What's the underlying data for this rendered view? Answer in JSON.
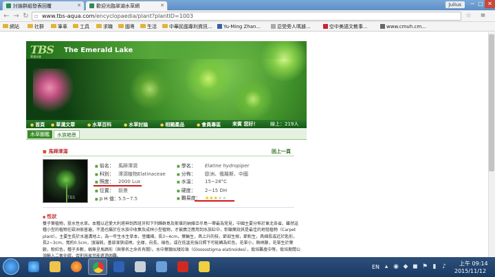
{
  "browser": {
    "tabs": [
      {
        "label": "討論群組發表回覆",
        "active": false
      },
      {
        "label": "歡迎光臨翠湖水草網",
        "active": true
      }
    ],
    "user_badge": "Julius",
    "window_controls": {
      "minimize": "─",
      "maximize": "□",
      "close": "✕"
    },
    "address": {
      "host": "www.tbs-aqua.com",
      "path": "/encyclopaedia/plant?plantID=1003"
    },
    "bookmarks": [
      "網站",
      "社群",
      "筆車",
      "工具",
      "求職",
      "國粵",
      "生活",
      "中華民國專利資訊...",
      "Yu-Ming Zhan...",
      "忍受旁人嗎據...",
      "空中美語文教事...",
      "www.cmuh.cm..."
    ]
  },
  "site": {
    "logo": "TBS",
    "logo_sub": "翠湖水族",
    "title": "The Emerald Lake",
    "nav": [
      "首頁",
      "草溝文章",
      "水草百科",
      "水草討論",
      "相關產品",
      "會員專區"
    ],
    "welcome": "來賓 您好！",
    "online": "線上：219人",
    "subnav": {
      "crumb": "水草圖鑑",
      "aquarium": "水族箱景"
    }
  },
  "plant": {
    "title": "馬蹄澤瀉",
    "back": "回上一頁",
    "photo_label": "TBS",
    "fields_left": [
      {
        "label": "俗名：",
        "value": "馬蹄澤瀉"
      },
      {
        "label": "科別：",
        "value": "澤瀉植物Elatinaceae"
      },
      {
        "label": "照度：",
        "value": "2000 Lux"
      },
      {
        "label": "位置：",
        "value": "前景"
      },
      {
        "label": "p H 值：",
        "value": "5.5~7.5"
      }
    ],
    "fields_right": [
      {
        "label": "學名：",
        "value": "Elatine hydropiper"
      },
      {
        "label": "分佈：",
        "value": "歐洲、俄羅斯、中國"
      },
      {
        "label": "水溫：",
        "value": "15~28°C"
      },
      {
        "label": "硬度：",
        "value": "2~15 DH"
      },
      {
        "label": "難易度：",
        "value": ""
      }
    ],
    "difficulty": 3,
    "difficulty_max": 5,
    "star_glyph": "★",
    "note_head": "性狀",
    "description": "雙子葉植物，挺水性水草。本種以近愛大利塔神到西班牙和下列歸群島及斯堪的納維亞半島一帶最為常見，中國主要分佈於東北各省。雖然這種小型的植物在歐洲很普遍，不過也屬於在水族中收集及成林小型植物，才被廣泛應用到水族缸中，彰顯葉說其是最佳的地毯植物（Carpet plant）。主要生長於水邊溝地上，為一年生水生草本，莖纖細，長3~4cm，葉輪生，具上升的枝，節部生根，節對生，具細長或近於匙形，長2~3cm，寬約0.5cm，頂端鈍，基部漸狹成柄，全緣，向長，綠色，或在低溫充強日照下可能轉為紅色，花單小，無柄腋，花單生於葉腋，粉紅色，種子多數，稱無呈馬蹄形（與學名之命名有關）。水中葉類似矮珍珠（Glossostigma elatinoides），栽培難度中等，栽培期間公須輸入二氧化碳，否則容易可能進過困難。"
  },
  "taskbar": {
    "lang": "EN",
    "time": "上午 09:14",
    "date": "2015/11/12"
  }
}
